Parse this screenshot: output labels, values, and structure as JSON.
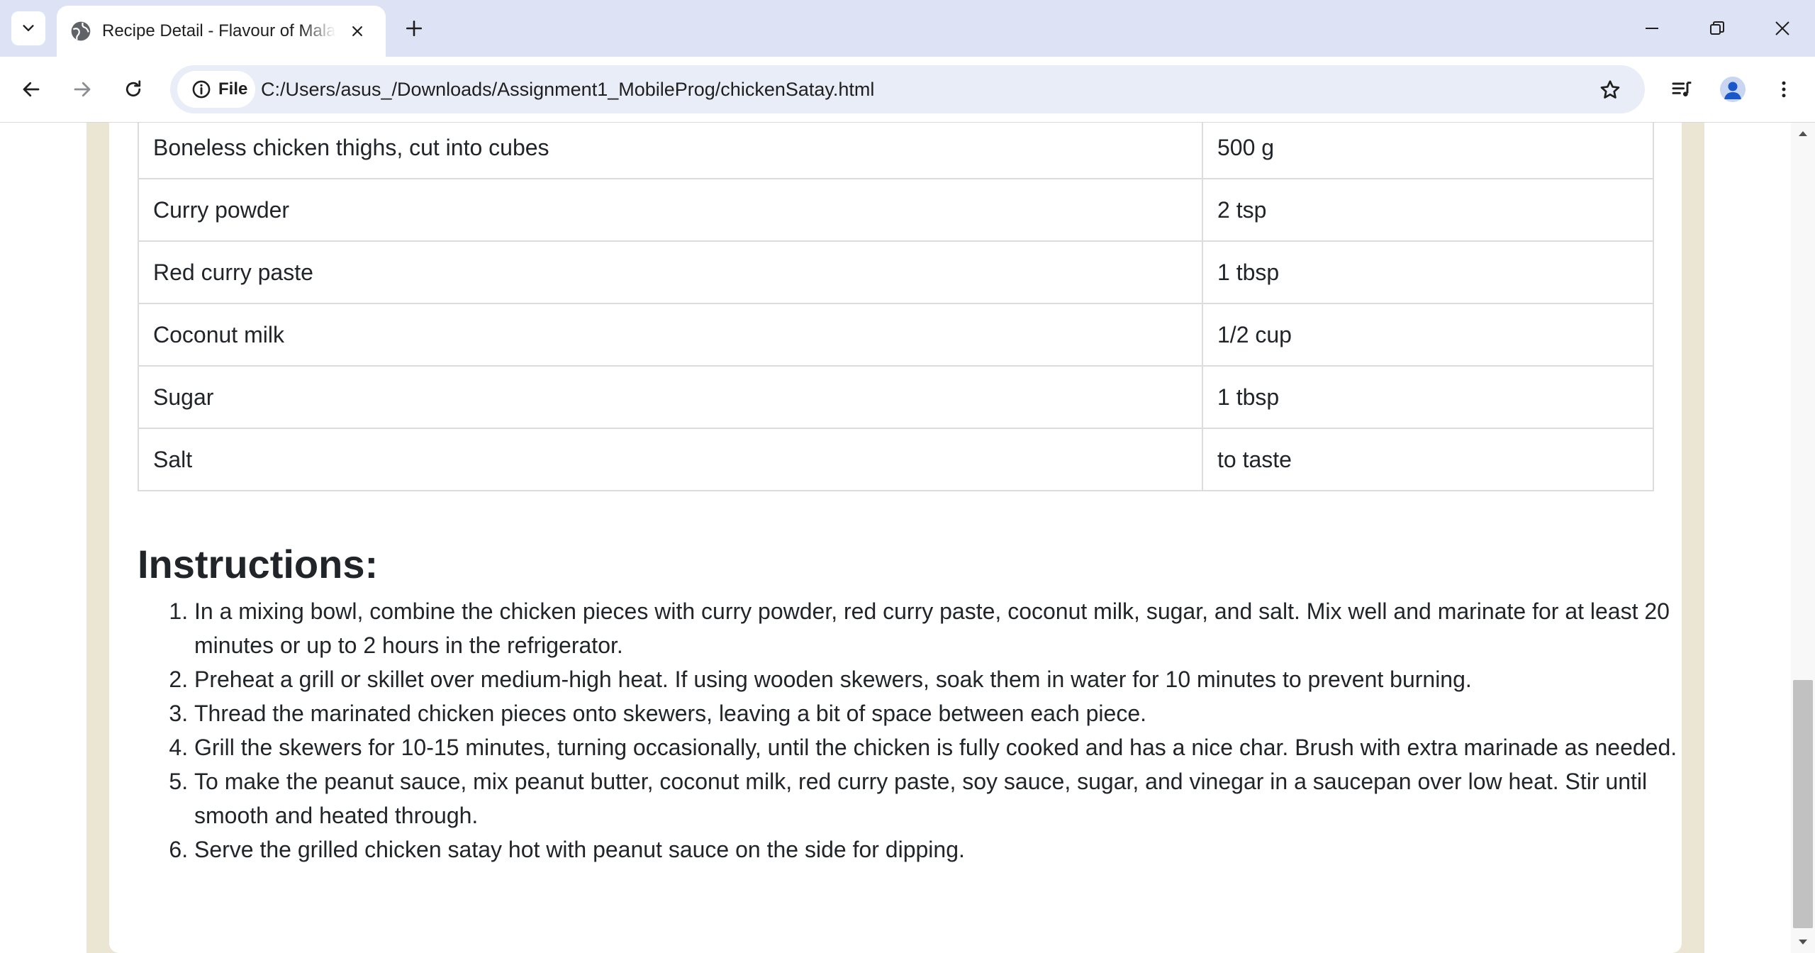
{
  "browser": {
    "tab": {
      "title": "Recipe Detail - Flavour of Malaysia"
    },
    "omnibox": {
      "chip_label": "File",
      "url": "C:/Users/asus_/Downloads/Assignment1_MobileProg/chickenSatay.html"
    }
  },
  "page": {
    "ingredients": [
      {
        "name": "Boneless chicken thighs, cut into cubes",
        "qty": "500 g"
      },
      {
        "name": "Curry powder",
        "qty": "2 tsp"
      },
      {
        "name": "Red curry paste",
        "qty": "1 tbsp"
      },
      {
        "name": "Coconut milk",
        "qty": "1/2 cup"
      },
      {
        "name": "Sugar",
        "qty": "1 tbsp"
      },
      {
        "name": "Salt",
        "qty": "to taste"
      }
    ],
    "instructions_heading": "Instructions:",
    "instructions": [
      "In a mixing bowl, combine the chicken pieces with curry powder, red curry paste, coconut milk, sugar, and salt. Mix well and marinate for at least 20 minutes or up to 2 hours in the refrigerator.",
      "Preheat a grill or skillet over medium-high heat. If using wooden skewers, soak them in water for 10 minutes to prevent burning.",
      "Thread the marinated chicken pieces onto skewers, leaving a bit of space between each piece.",
      "Grill the skewers for 10-15 minutes, turning occasionally, until the chicken is fully cooked and has a nice char. Brush with extra marinade as needed.",
      "To make the peanut sauce, mix peanut butter, coconut milk, red curry paste, soy sauce, sugar, and vinegar in a saucepan over low heat. Stir until smooth and heated through.",
      "Serve the grilled chicken satay hot with peanut sauce on the side for dipping."
    ]
  },
  "colors": {
    "tabstrip": "#dde3f5",
    "omnibox": "#e9edf7",
    "page_background": "#ebe6d3",
    "text": "#212529",
    "table_border": "#dcdcdc"
  },
  "icons": {
    "tab_search": "chevron-down-icon",
    "favicon": "globe-icon",
    "tab_close": "close-icon",
    "new_tab": "plus-icon",
    "minimize": "minimize-icon",
    "restore": "restore-icon",
    "window_close": "close-icon",
    "back": "arrow-left-icon",
    "forward": "arrow-right-icon",
    "reload": "reload-icon",
    "site_info": "info-icon",
    "bookmark": "star-icon",
    "media": "playlist-icon",
    "profile": "avatar-icon",
    "menu": "more-vertical-icon"
  }
}
